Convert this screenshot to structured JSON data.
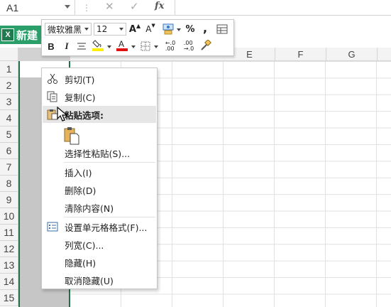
{
  "formula_bar": {
    "name_box": "A1",
    "separator": "⋮",
    "cancel_icon": "✕",
    "enter_icon": "✓",
    "fx_label": "fx"
  },
  "sheet_tab": {
    "label": "新建",
    "icon_letter": "X"
  },
  "columns": [
    "E",
    "F",
    "G"
  ],
  "rows": [
    "1",
    "2",
    "3",
    "4",
    "5",
    "6",
    "7",
    "8",
    "9",
    "10",
    "11",
    "12",
    "13",
    "14",
    "15"
  ],
  "mini_toolbar": {
    "font_name": "微软雅黑",
    "font_size": "12",
    "grow_font": "A",
    "shrink_font": "A",
    "bold": "B",
    "italic": "I",
    "percent": "%",
    "comma": ",",
    "increase_decimal": "←.0\n.00",
    "decrease_decimal": ".00\n→.0",
    "accent_fill": "#ffef00",
    "accent_font": "#e01010"
  },
  "context_menu": {
    "items": [
      {
        "label": "剪切(T)",
        "icon": "scissors-icon"
      },
      {
        "label": "复制(C)",
        "icon": "copy-icon"
      },
      {
        "label": "粘贴选项:",
        "icon": "paste-icon"
      },
      {
        "label": "",
        "icon": "paste-default-icon"
      },
      {
        "label": "选择性粘贴(S)...",
        "icon": ""
      },
      {
        "label": "插入(I)",
        "icon": ""
      },
      {
        "label": "删除(D)",
        "icon": ""
      },
      {
        "label": "清除内容(N)",
        "icon": ""
      },
      {
        "label": "设置单元格格式(F)...",
        "icon": "format-cells-icon"
      },
      {
        "label": "列宽(C)...",
        "icon": ""
      },
      {
        "label": "隐藏(H)",
        "icon": ""
      },
      {
        "label": "取消隐藏(U)",
        "icon": ""
      }
    ]
  }
}
